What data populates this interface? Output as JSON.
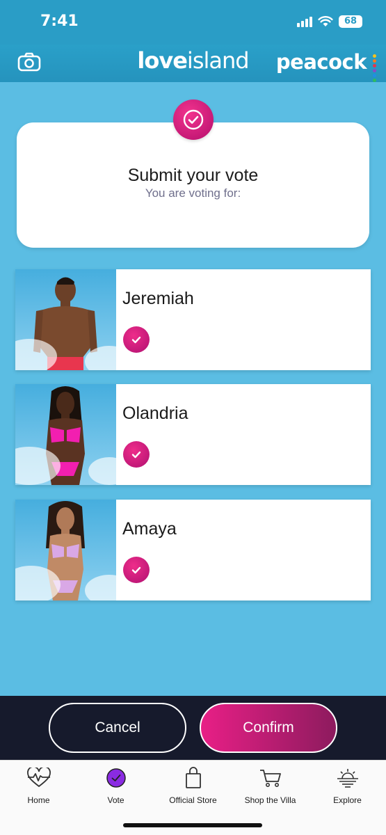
{
  "status_bar": {
    "time": "7:41",
    "battery": "68"
  },
  "header": {
    "brand_bold": "love",
    "brand_light": "island",
    "partner": "peacock"
  },
  "card": {
    "title": "Submit your vote",
    "subtitle": "You are voting for:"
  },
  "candidates": [
    {
      "name": "Jeremiah",
      "selected": true
    },
    {
      "name": "Olandria",
      "selected": true
    },
    {
      "name": "Amaya",
      "selected": true
    }
  ],
  "actions": {
    "cancel": "Cancel",
    "confirm": "Confirm"
  },
  "tabs": [
    {
      "label": "Home",
      "icon": "heartbeat-icon"
    },
    {
      "label": "Vote",
      "icon": "vote-check-icon",
      "active": true
    },
    {
      "label": "Official Store",
      "icon": "shopping-bag-icon"
    },
    {
      "label": "Shop the Villa",
      "icon": "cart-icon"
    },
    {
      "label": "Explore",
      "icon": "sunset-icon"
    }
  ],
  "colors": {
    "background": "#5bbde3",
    "header": "#2593bd",
    "accent_pink": "#e81f86",
    "action_bar": "#161a2c",
    "vote_tab": "#8a2be2"
  }
}
